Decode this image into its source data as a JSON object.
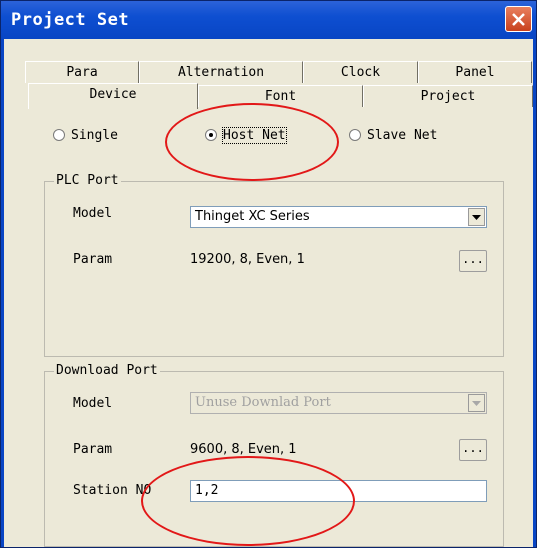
{
  "window": {
    "title": "Project Set"
  },
  "tabs": {
    "row1": [
      "Para",
      "Alternation",
      "Clock",
      "Panel"
    ],
    "row2": [
      "Device",
      "Font",
      "Project"
    ]
  },
  "mode": {
    "options": [
      {
        "label": "Single",
        "selected": false
      },
      {
        "label": "Host Net",
        "selected": true
      },
      {
        "label": "Slave Net",
        "selected": false
      }
    ]
  },
  "plc_port": {
    "title": "PLC Port",
    "model_label": "Model",
    "model_value": "Thinget XC Series",
    "param_label": "Param",
    "param_value": "19200, 8, Even, 1",
    "param_button": "..."
  },
  "download_port": {
    "title": "Download Port",
    "model_label": "Model",
    "model_value": "Unuse Downlad Port",
    "param_label": "Param",
    "param_value": "9600, 8, Even, 1",
    "param_button": "...",
    "station_label": "Station NO",
    "station_value": "1,2"
  },
  "annotation_color": "#e21818"
}
